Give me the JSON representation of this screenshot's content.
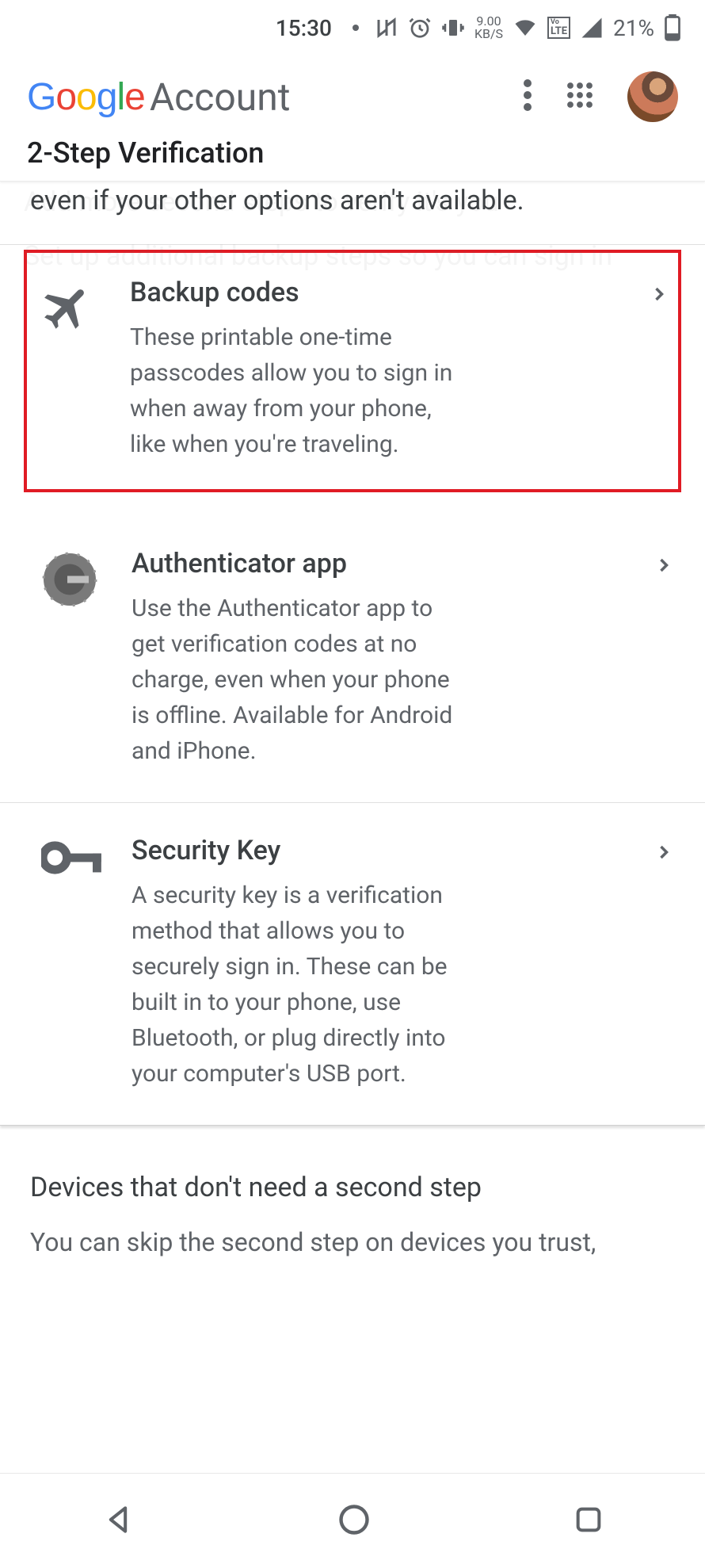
{
  "status": {
    "time": "15:30",
    "net_speed": "9.00",
    "net_unit": "KB/S",
    "lte_badge": "LTE",
    "battery_pct": "21%"
  },
  "header": {
    "brand_google": "Google",
    "brand_account": "Account"
  },
  "page": {
    "title": "2-Step Verification",
    "ghost_heading": "Add more second steps to verify it's you",
    "ghost_sub": "Set up additional backup steps so you can sign in",
    "intro_tail": "even if your other options aren't available."
  },
  "options": [
    {
      "title": "Backup codes",
      "desc": "These printable one-time passcodes allow you to sign in when away from your phone, like when you're traveling."
    },
    {
      "title": "Authenticator app",
      "desc": "Use the Authenticator app to get verification codes at no charge, even when your phone is offline. Available for Android and iPhone."
    },
    {
      "title": "Security Key",
      "desc": "A security key is a verification method that allows you to securely sign in. These can be built in to your phone, use Bluetooth, or plug directly into your computer's USB port."
    }
  ],
  "devices": {
    "title": "Devices that don't need a second step",
    "desc": "You can skip the second step on devices you trust,"
  }
}
